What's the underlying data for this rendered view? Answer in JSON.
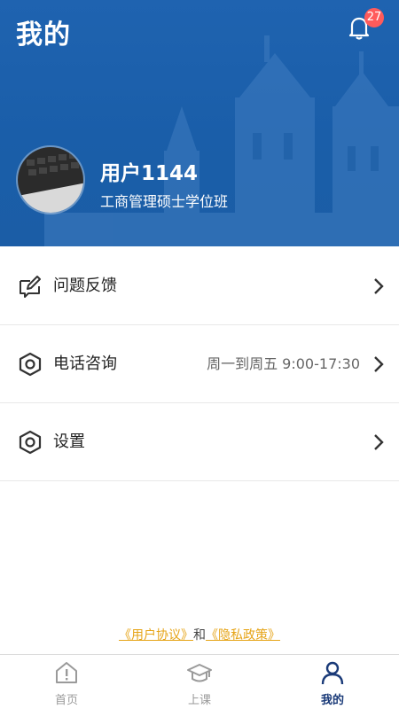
{
  "header": {
    "title": "我的",
    "notification_count": "27"
  },
  "profile": {
    "username": "用户1144",
    "program": "工商管理硕士学位班"
  },
  "menu": [
    {
      "label": "问题反馈",
      "value": "",
      "icon": "feedback-edit-icon"
    },
    {
      "label": "电话咨询",
      "value": "周一到周五 9:00-17:30",
      "icon": "hexagon-nut-icon"
    },
    {
      "label": "设置",
      "value": "",
      "icon": "hexagon-nut-icon"
    }
  ],
  "agreements": {
    "user_agreement": "《用户协议》",
    "and": "和",
    "privacy_policy": "《隐私政策》"
  },
  "tabbar": {
    "items": [
      {
        "label": "首页",
        "icon": "home-icon",
        "active": false
      },
      {
        "label": "上课",
        "icon": "graduation-cap-icon",
        "active": false
      },
      {
        "label": "我的",
        "icon": "person-icon",
        "active": true
      }
    ]
  },
  "colors": {
    "header_blue": "#1f63b0",
    "accent_link": "#e6a417",
    "badge_red": "#ff5b5b",
    "active_tab": "#1a3a78"
  }
}
